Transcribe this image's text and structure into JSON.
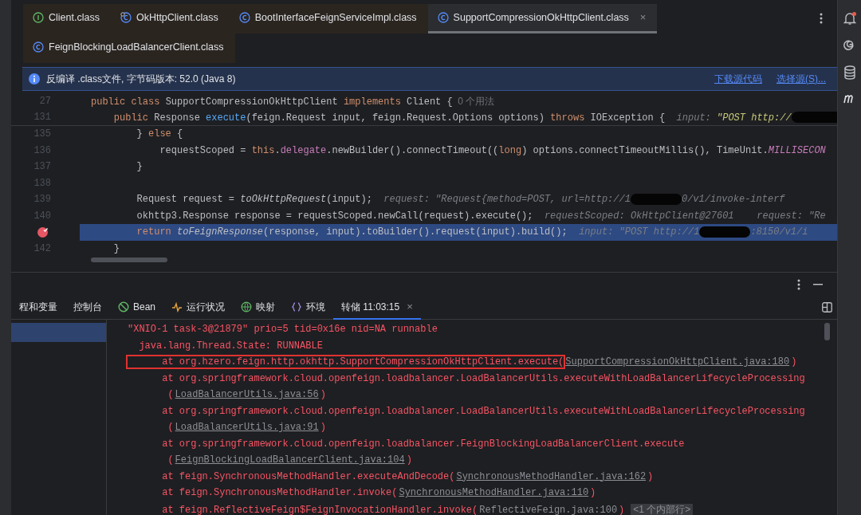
{
  "editor_tabs": [
    {
      "label": "Client.class",
      "kind": "interface",
      "selected": false
    },
    {
      "label": "OkHttpClient.class",
      "kind": "linked",
      "selected": false
    },
    {
      "label": "BootInterfaceFeignServiceImpl.class",
      "kind": "class",
      "selected": false
    },
    {
      "label": "SupportCompressionOkHttpClient.class",
      "kind": "class",
      "selected": true,
      "close": "×"
    },
    {
      "label": "FeignBlockingLoadBalancerClient.class",
      "kind": "class",
      "selected": false
    }
  ],
  "info_bar": {
    "text": "反编译 .class文件, 字节码版本: 52.0 (Java 8)",
    "actions": [
      "下载源代码",
      "选择源(S)..."
    ]
  },
  "sticky_lines": [
    {
      "number": "27",
      "breakpoint": false,
      "selected": false,
      "segments": [
        {
          "text": "public class ",
          "kind": "kw"
        },
        {
          "text": "SupportCompressionOkHttpClient ",
          "kind": "plain"
        },
        {
          "text": "implements ",
          "kind": "kw"
        },
        {
          "text": "Client {",
          "kind": "plain"
        },
        {
          "text": "  0 个用法",
          "kind": "usage"
        }
      ]
    },
    {
      "number": "131",
      "breakpoint": false,
      "selected": false,
      "segments": [
        {
          "text": "    public ",
          "kind": "kw"
        },
        {
          "text": "Response ",
          "kind": "plain"
        },
        {
          "text": "execute",
          "kind": "fn"
        },
        {
          "text": "(feign.Request input, feign.Request.Options options) ",
          "kind": "plain"
        },
        {
          "text": "throws ",
          "kind": "kw"
        },
        {
          "text": "IOException {",
          "kind": "plain"
        },
        {
          "text": "  input: ",
          "kind": "hint"
        },
        {
          "text": "\"POST http://",
          "kind": "hint-value"
        },
        {
          "kind": "masked"
        }
      ]
    }
  ],
  "code_lines": [
    {
      "number": "135",
      "breakpoint": false,
      "selected": false,
      "segments": [
        {
          "text": "        } ",
          "kind": "plain"
        },
        {
          "text": "else ",
          "kind": "kw"
        },
        {
          "text": "{",
          "kind": "plain"
        }
      ]
    },
    {
      "number": "136",
      "breakpoint": false,
      "selected": false,
      "segments": [
        {
          "text": "            requestScoped = ",
          "kind": "plain"
        },
        {
          "text": "this",
          "kind": "kw"
        },
        {
          "text": ".",
          "kind": "plain"
        },
        {
          "text": "delegate",
          "kind": "field"
        },
        {
          "text": ".newBuilder().connectTimeout((",
          "kind": "plain"
        },
        {
          "text": "long",
          "kind": "kw"
        },
        {
          "text": ") options.connectTimeoutMillis(), TimeUnit.",
          "kind": "plain"
        },
        {
          "text": "MILLISECON",
          "kind": "const"
        }
      ]
    },
    {
      "number": "137",
      "breakpoint": false,
      "selected": false,
      "segments": [
        {
          "text": "        }",
          "kind": "plain"
        }
      ]
    },
    {
      "number": "138",
      "breakpoint": false,
      "selected": false
    },
    {
      "number": "139",
      "breakpoint": false,
      "selected": false,
      "segments": [
        {
          "text": "        Request request = ",
          "kind": "plain"
        },
        {
          "text": "toOkHttpRequest",
          "kind": "static"
        },
        {
          "text": "(input);",
          "kind": "plain"
        },
        {
          "text": "  request: \"Request{method=POST, url=http://1",
          "kind": "hint"
        },
        {
          "kind": "masked"
        },
        {
          "text": "0/v1/invoke-interf",
          "kind": "hint"
        }
      ]
    },
    {
      "number": "140",
      "breakpoint": false,
      "selected": false,
      "segments": [
        {
          "text": "        okhttp3.Response response = requestScoped.newCall(request).execute();",
          "kind": "plain"
        },
        {
          "text": "  requestScoped: OkHttpClient@27601    request: \"Re",
          "kind": "hint"
        }
      ]
    },
    {
      "breakpoint": true,
      "selected": true,
      "segments": [
        {
          "text": "        return ",
          "kind": "kw"
        },
        {
          "text": "toFeignResponse",
          "kind": "static"
        },
        {
          "text": "(response, input).toBuilder().request(input).build();",
          "kind": "plain"
        },
        {
          "text": "  input: \"POST http://1",
          "kind": "hint"
        },
        {
          "kind": "masked"
        },
        {
          "text": ":8150/v1/i",
          "kind": "hint"
        }
      ]
    },
    {
      "number": "142",
      "breakpoint": false,
      "selected": false,
      "segments": [
        {
          "text": "    }",
          "kind": "plain"
        }
      ]
    }
  ],
  "debug_tabs": [
    {
      "label": "程和变量",
      "selected": false
    },
    {
      "label": "控制台",
      "selected": false
    },
    {
      "label": "Bean",
      "kind": "bean",
      "selected": false
    },
    {
      "label": "运行状况",
      "kind": "pulse",
      "selected": false
    },
    {
      "label": "映射",
      "kind": "globe",
      "selected": false
    },
    {
      "label": "环境",
      "kind": "braces",
      "selected": false
    },
    {
      "label": "转储 11:03:15",
      "selected": true,
      "close": "×"
    }
  ],
  "console_lines": [
    {
      "boxed": false,
      "segments": [
        {
          "text": "\"XNIO-1 task-3@21879\" prio=5 tid=0x16e nid=NA runnable",
          "kind": "error"
        }
      ]
    },
    {
      "boxed": false,
      "segments": [
        {
          "text": "  java.lang.Thread.State: RUNNABLE",
          "kind": "error"
        }
      ]
    },
    {
      "boxed": true,
      "segments": [
        {
          "text": "      at org.hzero.feign.http.okhttp.SupportCompressionOkHttpClient.execute(",
          "kind": "error"
        },
        {
          "text": "SupportCompressionOkHttpClient.java:180",
          "kind": "link"
        },
        {
          "text": ")",
          "kind": "error"
        }
      ]
    },
    {
      "boxed": false,
      "segments": [
        {
          "text": "      at org.springframework.cloud.openfeign.loadbalancer.LoadBalancerUtils.executeWithLoadBalancerLifecycleProcessing",
          "kind": "error"
        }
      ]
    },
    {
      "boxed": false,
      "segments": [
        {
          "text": "       (",
          "kind": "error"
        },
        {
          "text": "LoadBalancerUtils.java:56",
          "kind": "link"
        },
        {
          "text": ")",
          "kind": "error"
        }
      ]
    },
    {
      "boxed": false,
      "segments": [
        {
          "text": "      at org.springframework.cloud.openfeign.loadbalancer.LoadBalancerUtils.executeWithLoadBalancerLifecycleProcessing",
          "kind": "error"
        }
      ]
    },
    {
      "boxed": false,
      "segments": [
        {
          "text": "       (",
          "kind": "error"
        },
        {
          "text": "LoadBalancerUtils.java:91",
          "kind": "link"
        },
        {
          "text": ")",
          "kind": "error"
        }
      ]
    },
    {
      "boxed": false,
      "segments": [
        {
          "text": "      at org.springframework.cloud.openfeign.loadbalancer.FeignBlockingLoadBalancerClient.execute",
          "kind": "error"
        }
      ]
    },
    {
      "boxed": false,
      "segments": [
        {
          "text": "       (",
          "kind": "error"
        },
        {
          "text": "FeignBlockingLoadBalancerClient.java:104",
          "kind": "link"
        },
        {
          "text": ")",
          "kind": "error"
        }
      ]
    },
    {
      "boxed": false,
      "segments": [
        {
          "text": "      at feign.SynchronousMethodHandler.executeAndDecode(",
          "kind": "error"
        },
        {
          "text": "SynchronousMethodHandler.java:162",
          "kind": "link"
        },
        {
          "text": ")",
          "kind": "error"
        }
      ]
    },
    {
      "boxed": false,
      "segments": [
        {
          "text": "      at feign.SynchronousMethodHandler.invoke(",
          "kind": "error"
        },
        {
          "text": "SynchronousMethodHandler.java:110",
          "kind": "link"
        },
        {
          "text": ")",
          "kind": "error"
        }
      ]
    },
    {
      "boxed": false,
      "folded": true,
      "segments": [
        {
          "text": "      at feign.ReflectiveFeign$FeignInvocationHandler.invoke(",
          "kind": "error"
        },
        {
          "text": "ReflectiveFeign.java:100",
          "kind": "link-muted"
        },
        {
          "text": ")",
          "kind": "error"
        },
        {
          "text": "<1 个内部行>",
          "kind": "fold"
        }
      ]
    }
  ]
}
